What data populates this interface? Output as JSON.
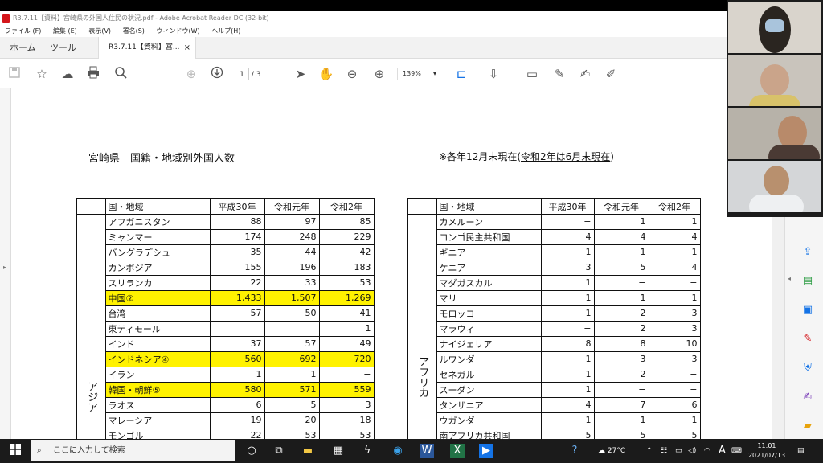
{
  "window": {
    "title": "R3.7.11【資料】宮崎県の外国人住民の状況.pdf - Adobe Acrobat Reader DC (32-bit)"
  },
  "menu": [
    "ファイル (F)",
    "編集 (E)",
    "表示(V)",
    "署名(S)",
    "ウィンドウ(W)",
    "ヘルプ(H)"
  ],
  "tabs": {
    "home": "ホーム",
    "tools": "ツール",
    "doc": "R3.7.11【資料】宮...",
    "close": "×"
  },
  "toolbar": {
    "page_current": "1",
    "page_total": "/ 3",
    "zoom": "139%"
  },
  "document": {
    "title": "宮崎県　国籍・地域別外国人数",
    "note_prefix": "※各年12月末現在",
    "note_paren_open": "(",
    "note_underlined": "令和2年は6月末現在",
    "note_paren_close": ")",
    "headers": [
      "国・地域",
      "平成30年",
      "令和元年",
      "令和2年"
    ],
    "left_region": "アジア",
    "left_rows": [
      {
        "name": "アフガニスタン",
        "h30": "88",
        "r1": "97",
        "r2": "85",
        "hl": false
      },
      {
        "name": "ミャンマー",
        "h30": "174",
        "r1": "248",
        "r2": "229",
        "hl": false
      },
      {
        "name": "バングラデシュ",
        "h30": "35",
        "r1": "44",
        "r2": "42",
        "hl": false
      },
      {
        "name": "カンボジア",
        "h30": "155",
        "r1": "196",
        "r2": "183",
        "hl": false
      },
      {
        "name": "スリランカ",
        "h30": "22",
        "r1": "33",
        "r2": "53",
        "hl": false
      },
      {
        "name": "中国②",
        "h30": "1,433",
        "r1": "1,507",
        "r2": "1,269",
        "hl": true
      },
      {
        "name": "台湾",
        "h30": "57",
        "r1": "50",
        "r2": "41",
        "hl": false
      },
      {
        "name": "東ティモール",
        "h30": "",
        "r1": "",
        "r2": "1",
        "hl": false
      },
      {
        "name": "インド",
        "h30": "37",
        "r1": "57",
        "r2": "49",
        "hl": false
      },
      {
        "name": "インドネシア④",
        "h30": "560",
        "r1": "692",
        "r2": "720",
        "hl": true
      },
      {
        "name": "イラン",
        "h30": "1",
        "r1": "1",
        "r2": "−",
        "hl": false
      },
      {
        "name": "韓国・朝鮮⑤",
        "h30": "580",
        "r1": "571",
        "r2": "559",
        "hl": true
      },
      {
        "name": "ラオス",
        "h30": "6",
        "r1": "5",
        "r2": "3",
        "hl": false
      },
      {
        "name": "マレーシア",
        "h30": "19",
        "r1": "20",
        "r2": "18",
        "hl": false
      },
      {
        "name": "モンゴル",
        "h30": "22",
        "r1": "53",
        "r2": "53",
        "hl": false
      }
    ],
    "right_region": "アフリカ",
    "right_rows": [
      {
        "name": "カメルーン",
        "h30": "−",
        "r1": "1",
        "r2": "1"
      },
      {
        "name": "コンゴ民主共和国",
        "h30": "4",
        "r1": "4",
        "r2": "4"
      },
      {
        "name": "ギニア",
        "h30": "1",
        "r1": "1",
        "r2": "1"
      },
      {
        "name": "ケニア",
        "h30": "3",
        "r1": "5",
        "r2": "4"
      },
      {
        "name": "マダガスカル",
        "h30": "1",
        "r1": "−",
        "r2": "−"
      },
      {
        "name": "マリ",
        "h30": "1",
        "r1": "1",
        "r2": "1"
      },
      {
        "name": "モロッコ",
        "h30": "1",
        "r1": "2",
        "r2": "3"
      },
      {
        "name": "マラウィ",
        "h30": "−",
        "r1": "2",
        "r2": "3"
      },
      {
        "name": "ナイジェリア",
        "h30": "8",
        "r1": "8",
        "r2": "10"
      },
      {
        "name": "ルワンダ",
        "h30": "1",
        "r1": "3",
        "r2": "3"
      },
      {
        "name": "セネガル",
        "h30": "1",
        "r1": "2",
        "r2": "−"
      },
      {
        "name": "スーダン",
        "h30": "1",
        "r1": "−",
        "r2": "−"
      },
      {
        "name": "タンザニア",
        "h30": "4",
        "r1": "7",
        "r2": "6"
      },
      {
        "name": "ウガンダ",
        "h30": "1",
        "r1": "1",
        "r2": "1"
      },
      {
        "name": "南アフリカ共和国",
        "h30": "5",
        "r1": "5",
        "r2": "5"
      }
    ]
  },
  "taskbar": {
    "search_placeholder": "ここに入力して検索",
    "temperature": "27°C",
    "ime": "A",
    "time": "11:01",
    "date": "2021/07/13"
  },
  "colors": {
    "highlight": "#fff200",
    "acrobat_red": "#d4161b",
    "taskbar": "#1b1b1b"
  }
}
